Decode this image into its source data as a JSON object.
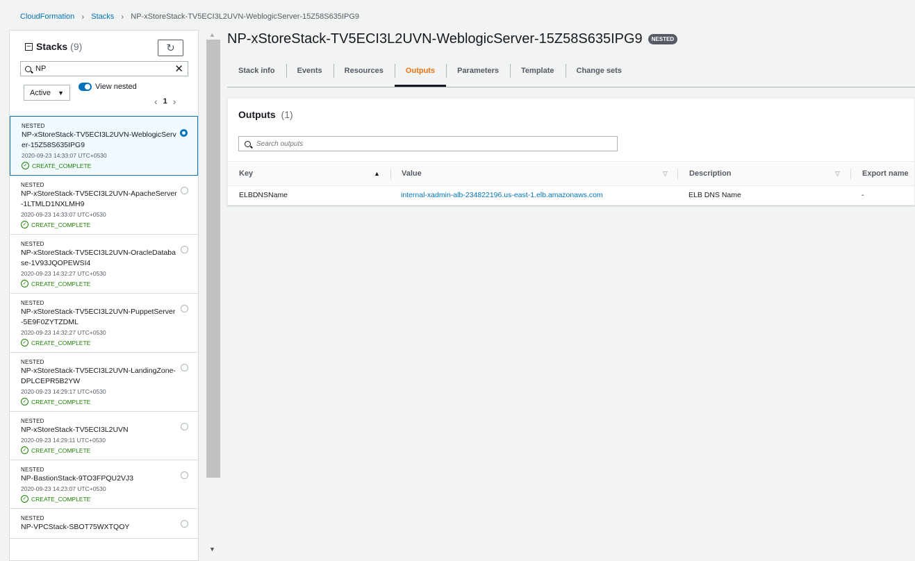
{
  "breadcrumb": {
    "root": "CloudFormation",
    "stacks": "Stacks",
    "current": "NP-xStoreStack-TV5ECI3L2UVN-WeblogicServer-15Z58S635IPG9"
  },
  "left_panel": {
    "title": "Stacks",
    "count": "(9)",
    "search_value": "NP",
    "status_filter": "Active",
    "view_nested_label": "View nested",
    "page": "1",
    "stacks": [
      {
        "tag": "NESTED",
        "name": "NP-xStoreStack-TV5ECI3L2UVN-WeblogicServer-15Z58S635IPG9",
        "date": "2020-09-23 14:33:07 UTC+0530",
        "status": "CREATE_COMPLETE",
        "selected": true
      },
      {
        "tag": "NESTED",
        "name": "NP-xStoreStack-TV5ECI3L2UVN-ApacheServer-1LTMLD1NXLMH9",
        "date": "2020-09-23 14:33:07 UTC+0530",
        "status": "CREATE_COMPLETE",
        "selected": false
      },
      {
        "tag": "NESTED",
        "name": "NP-xStoreStack-TV5ECI3L2UVN-OracleDatabase-1V93JQOPEWSI4",
        "date": "2020-09-23 14:32:27 UTC+0530",
        "status": "CREATE_COMPLETE",
        "selected": false
      },
      {
        "tag": "NESTED",
        "name": "NP-xStoreStack-TV5ECI3L2UVN-PuppetServer-5E9F0ZYTZDML",
        "date": "2020-09-23 14:32:27 UTC+0530",
        "status": "CREATE_COMPLETE",
        "selected": false
      },
      {
        "tag": "NESTED",
        "name": "NP-xStoreStack-TV5ECI3L2UVN-LandingZone-DPLCEPR5B2YW",
        "date": "2020-09-23 14:29:17 UTC+0530",
        "status": "CREATE_COMPLETE",
        "selected": false
      },
      {
        "tag": "NESTED",
        "name": "NP-xStoreStack-TV5ECI3L2UVN",
        "date": "2020-09-23 14:29:11 UTC+0530",
        "status": "CREATE_COMPLETE",
        "selected": false
      },
      {
        "tag": "NESTED",
        "name": "NP-BastionStack-9TO3FPQU2VJ3",
        "date": "2020-09-23 14:23:07 UTC+0530",
        "status": "CREATE_COMPLETE",
        "selected": false
      },
      {
        "tag": "NESTED",
        "name": "NP-VPCStack-SBOT75WXTQOY",
        "date": "",
        "status": "",
        "selected": false
      }
    ]
  },
  "main": {
    "title": "NP-xStoreStack-TV5ECI3L2UVN-WeblogicServer-15Z58S635IPG9",
    "badge": "NESTED",
    "tabs": [
      "Stack info",
      "Events",
      "Resources",
      "Outputs",
      "Parameters",
      "Template",
      "Change sets"
    ],
    "active_tab": "Outputs",
    "outputs": {
      "title": "Outputs",
      "count": "(1)",
      "search_placeholder": "Search outputs",
      "columns": [
        "Key",
        "Value",
        "Description",
        "Export name"
      ],
      "rows": [
        {
          "key": "ELBDNSName",
          "value": "internal-xadmin-alb-234822196.us-east-1.elb.amazonaws.com",
          "description": "ELB DNS Name",
          "export": "-"
        }
      ]
    }
  },
  "colors": {
    "link": "#0073bb",
    "active_tab": "#ec7211",
    "success": "#1d8102"
  }
}
